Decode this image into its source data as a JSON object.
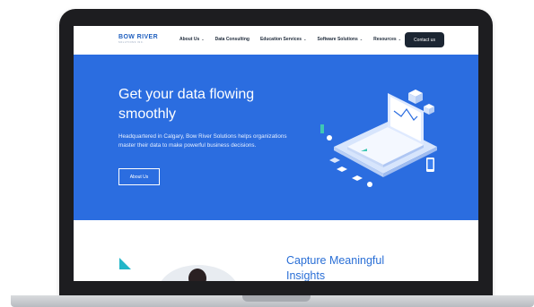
{
  "header": {
    "logo": {
      "name": "BOW RIVER",
      "sub": "SOLUTIONS INC."
    },
    "menu": [
      {
        "label": "About Us",
        "has_dropdown": true
      },
      {
        "label": "Data Consulting",
        "has_dropdown": false
      },
      {
        "label": "Education Services",
        "has_dropdown": true
      },
      {
        "label": "Software Solutions",
        "has_dropdown": true
      },
      {
        "label": "Resources",
        "has_dropdown": true
      }
    ],
    "contact_label": "Contact us"
  },
  "hero": {
    "title": "Get your data flowing smoothly",
    "description": "Headquartered in Calgary, Bow River Solutions helps organizations master their data to make powerful business decisions.",
    "button_label": "About Us"
  },
  "section": {
    "title": "Capture Meaningful Insights"
  },
  "colors": {
    "hero_bg": "#2b6de0",
    "accent": "#2a6fd6",
    "contact_bg": "#1c2633",
    "teal": "#22b6c8"
  },
  "icons": {
    "dropdown": "chevron-down-icon",
    "illustration": "isometric-laptop-illustration"
  }
}
